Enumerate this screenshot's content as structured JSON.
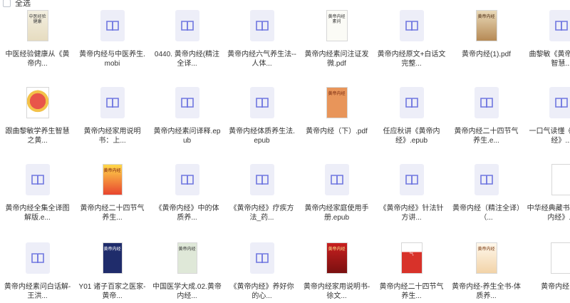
{
  "toolbar": {
    "select_all_label": "全选"
  },
  "items": [
    {
      "label": "中医经验健康从《黄帝内...",
      "type": "cover"
    },
    {
      "label": "黄帝内经与中医养生.mobi",
      "type": "doc"
    },
    {
      "label": "0440. 黄帝内经(精注全译...",
      "type": "doc"
    },
    {
      "label": "黄帝内经六气养生法--人体...",
      "type": "doc"
    },
    {
      "label": "黄帝内经素问注证发微.pdf",
      "type": "cover"
    },
    {
      "label": "黄帝内经原文+白话文完整...",
      "type": "doc"
    },
    {
      "label": "黄帝内经(1).pdf",
      "type": "cover"
    },
    {
      "label": "曲黎敏《黄帝内经》智慧...",
      "type": "doc"
    },
    {
      "label": "跟曲黎敏学养生智慧之黄...",
      "type": "cover"
    },
    {
      "label": "黄帝内经家用说明书：上...",
      "type": "doc"
    },
    {
      "label": "黄帝内经素问译释.epub",
      "type": "doc"
    },
    {
      "label": "黄帝内经体质养生法.epub",
      "type": "doc"
    },
    {
      "label": "黄帝内经（下）.pdf",
      "type": "cover"
    },
    {
      "label": "任应秋讲《黄帝内经》.epub",
      "type": "doc"
    },
    {
      "label": "黄帝内经二十四节气养生.e...",
      "type": "doc"
    },
    {
      "label": "一口气读懂《黄帝内经》...",
      "type": "doc"
    },
    {
      "label": "黄帝内经全集全译图解版.e...",
      "type": "doc"
    },
    {
      "label": "黄帝内经二十四节气养生...",
      "type": "cover"
    },
    {
      "label": "《黄帝内经》中的体质养...",
      "type": "doc"
    },
    {
      "label": "《黄帝内经》疗疾方法_药...",
      "type": "doc"
    },
    {
      "label": "黄帝内经家庭使用手册.epub",
      "type": "doc"
    },
    {
      "label": "《黄帝内经》针法针方讲...",
      "type": "doc"
    },
    {
      "label": "黄帝内经（精注全译）（...",
      "type": "doc"
    },
    {
      "label": "中华经典藏书+《黄帝内经》...",
      "type": "cover"
    },
    {
      "label": "黄帝内经素问白话解-王洪...",
      "type": "doc"
    },
    {
      "label": "Y01 诸子百家之医家-黄帝...",
      "type": "cover"
    },
    {
      "label": "中国医学大成.02.黄帝内经...",
      "type": "cover"
    },
    {
      "label": "《黄帝内经》养好你的心...",
      "type": "doc"
    },
    {
      "label": "黄帝内经家用说明书-徐文...",
      "type": "cover"
    },
    {
      "label": "黄帝内经二十四节气养生...",
      "type": "cover"
    },
    {
      "label": "黄帝内经-养生全书-体质养...",
      "type": "cover"
    },
    {
      "label": "黄帝内经.pdf",
      "type": "cover"
    }
  ],
  "cover_texts": {
    "c0": "中医经验健康",
    "c4": "黄帝内经素问",
    "c6": "黄帝内经",
    "c12": "黄帝内经",
    "c17": "黄帝内经",
    "c25": "黄帝内经",
    "c26": "黄帝内经",
    "c28": "黄帝内经",
    "c29": "二十四节气",
    "c30": "黄帝内经"
  },
  "colors": {
    "doc_bg": "#edeef8",
    "doc_icon": "#6f76e0"
  }
}
